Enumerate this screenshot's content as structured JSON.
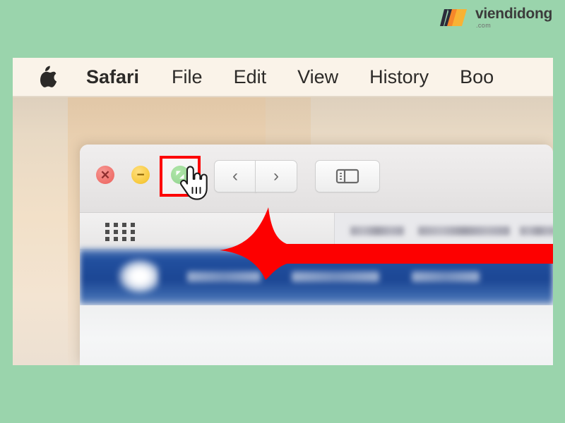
{
  "brand": {
    "name": "viendidong",
    "suffix": ".com",
    "logo_icon": "viendidong-logo",
    "dark_color": "#2b2b3a",
    "orange_color": "#f5872a",
    "yellow_color": "#f9b233"
  },
  "page": {
    "background_color": "#9ad4ac",
    "screenshot_title": "macOS Safari window controls"
  },
  "menubar": {
    "apple_icon": "apple-logo-icon",
    "items": [
      {
        "label": "Safari",
        "bold": true
      },
      {
        "label": "File",
        "bold": false
      },
      {
        "label": "Edit",
        "bold": false
      },
      {
        "label": "View",
        "bold": false
      },
      {
        "label": "History",
        "bold": false
      },
      {
        "label": "Boo",
        "bold": false
      }
    ],
    "background_color": "#faf3e9"
  },
  "desktop": {
    "wallpaper_description": "beige gradient wallpaper"
  },
  "window": {
    "traffic_lights": [
      {
        "name": "close",
        "glyph": "✕",
        "color": "#ef6f6a"
      },
      {
        "name": "minimize",
        "glyph": "−",
        "color": "#f7c93c"
      },
      {
        "name": "maximize",
        "glyph": "",
        "color": "#20a818"
      }
    ],
    "highlight": {
      "target": "maximize-button",
      "border_color": "#fd0000"
    },
    "cursor": {
      "type": "pointing-hand-cursor"
    },
    "toolbar": {
      "back_icon": "chevron-left-icon",
      "back_glyph": "‹",
      "forward_icon": "chevron-right-icon",
      "forward_glyph": "›",
      "sidebar_icon": "sidebar-toggle-icon"
    },
    "bookmarks_bar": {
      "grid_icon": "favorites-grid-icon",
      "grid_columns": 4,
      "grid_rows": 3
    },
    "content": {
      "selected_row_color": "#1b4694",
      "selected_row_icon": "bird-icon",
      "blurred": true
    }
  },
  "annotation": {
    "arrow_color": "#fd0000",
    "arrow_direction": "left",
    "arrow_points_to": "maximize-button"
  }
}
